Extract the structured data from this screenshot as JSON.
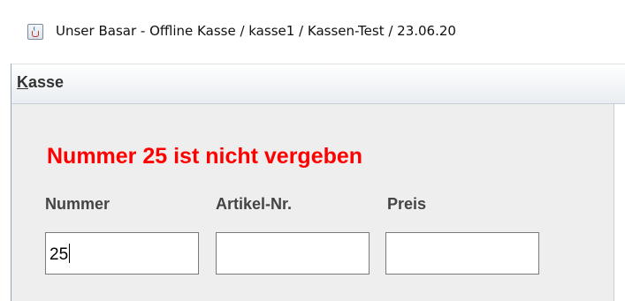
{
  "window": {
    "title": "Unser Basar - Offline Kasse / kasse1 / Kassen-Test / 23.06.20",
    "icon": "java-cup-icon"
  },
  "menubar": {
    "items": [
      {
        "mnemonic": "K",
        "rest": "asse"
      }
    ]
  },
  "main": {
    "error_message": "Nummer 25 ist nicht vergeben",
    "error_color": "#ff0000",
    "fields": [
      {
        "label": "Nummer",
        "value": "25"
      },
      {
        "label": "Artikel-Nr.",
        "value": ""
      },
      {
        "label": "Preis",
        "value": ""
      }
    ]
  }
}
